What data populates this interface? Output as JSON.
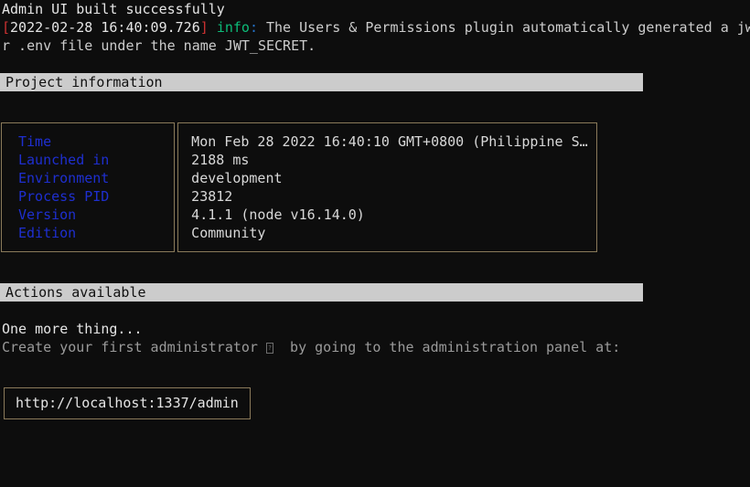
{
  "terminal": {
    "background": "#0d0d0d",
    "foreground": "#cccccc"
  },
  "log": {
    "line1": "Admin UI built successfully",
    "line2": {
      "bracket_open": "[",
      "timestamp": "2022-02-28 16:40:09.726",
      "bracket_close": "]",
      "level": "info",
      "colon": ":",
      "message": " The Users & Permissions plugin automatically generated a jw"
    },
    "line3": "r .env file under the name JWT_SECRET."
  },
  "sections": {
    "project_information": "Project information",
    "actions_available": "Actions available"
  },
  "project_info": {
    "labels": [
      "Time",
      "Launched in",
      "Environment",
      "Process PID",
      "Version",
      "Edition"
    ],
    "values": [
      "Mon Feb 28 2022 16:40:10 GMT+0800 (Philippine S…",
      "2188 ms",
      "development",
      "23812",
      "4.1.1 (node v16.14.0)",
      "Community"
    ]
  },
  "actions": {
    "headline": "One more thing...",
    "instruction_before": "Create your first administrator ",
    "instruction_glyph": "?",
    "instruction_after": "  by going to the administration panel at:",
    "admin_url": "http://localhost:1337/admin"
  },
  "colors": {
    "label_blue": "#1e2fd0",
    "info_green": "#0dbc79",
    "bracket_red": "#cd3131",
    "border_tan": "#8a7a5a",
    "bar_gray": "#cccccc"
  }
}
